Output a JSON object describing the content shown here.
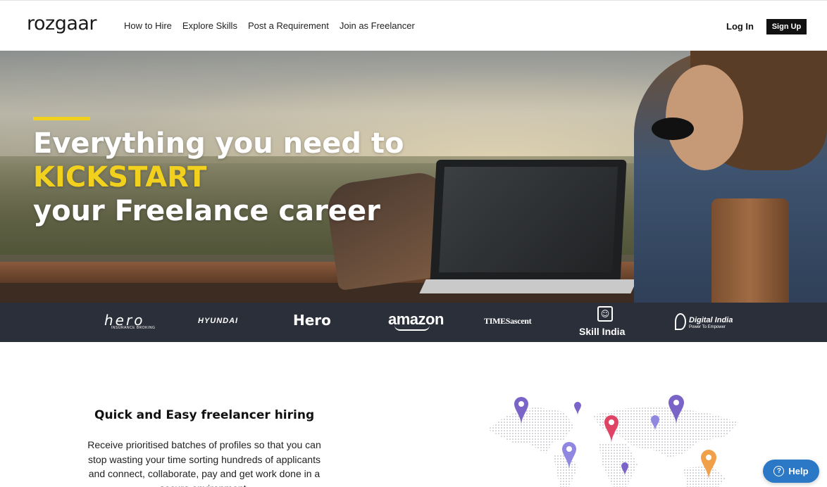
{
  "header": {
    "logo": "rozgaar",
    "nav": [
      "How to Hire",
      "Explore Skills",
      "Post a Requirement",
      "Join as Freelancer"
    ],
    "login_label": "Log In",
    "signup_label": "Sign Up"
  },
  "hero": {
    "line1": "Everything you need to",
    "line2": "KICKSTART",
    "line3": "your Freelance career",
    "accent_color": "#f2d01e"
  },
  "brands": {
    "hero_insurance": "hero",
    "hero_insurance_sub": "INSURANCE BROKING",
    "hyundai": "HYUNDAI",
    "hero": "Hero",
    "amazon": "amazon",
    "times": "TIMESascent",
    "skill_india": "Skill India",
    "digital_india": "Digital India",
    "digital_india_sub": "Power To Empower"
  },
  "section": {
    "title": "Quick and Easy freelancer hiring",
    "body": "Receive prioritised batches of profiles so that you can stop wasting your time sorting hundreds of applicants and connect, collaborate, pay and get work done in a secure environment."
  },
  "help": {
    "label": "Help",
    "icon": "help-icon"
  }
}
